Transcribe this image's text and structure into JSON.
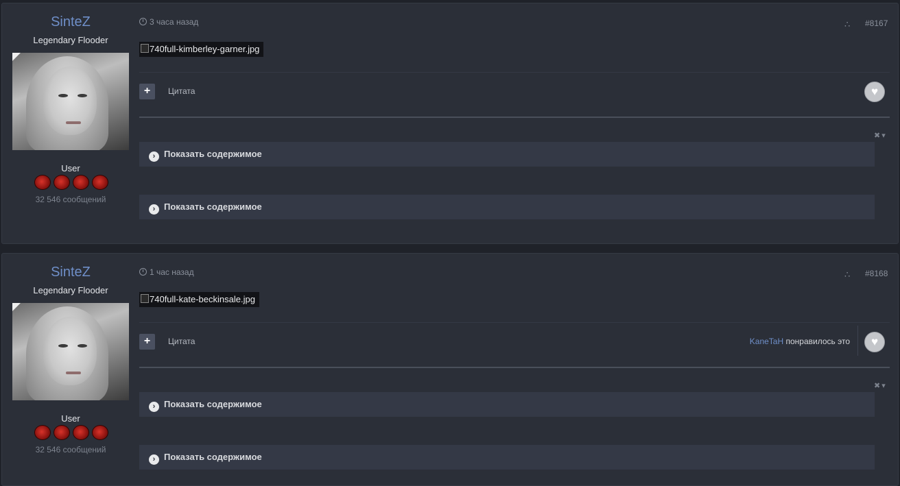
{
  "posts": [
    {
      "author": {
        "name": "SinteZ",
        "title": "Legendary Flooder",
        "group": "User",
        "post_count": "32 546 сообщений"
      },
      "time": "3 часа назад",
      "post_number": "#8167",
      "image_alt": "740full-kimberley-garner.jpg",
      "quote_label": "Цитата",
      "liked_by": "",
      "liked_text": "",
      "spoilers": [
        "Показать содержимое",
        "Показать содержимое"
      ]
    },
    {
      "author": {
        "name": "SinteZ",
        "title": "Legendary Flooder",
        "group": "User",
        "post_count": "32 546 сообщений"
      },
      "time": "1 час назад",
      "post_number": "#8168",
      "image_alt": "740full-kate-beckinsale.jpg",
      "quote_label": "Цитата",
      "liked_by": "KaneTaH",
      "liked_text": "понравилось это",
      "spoilers": [
        "Показать содержимое",
        "Показать содержимое"
      ]
    }
  ],
  "icons": {
    "clock": "clock-icon",
    "share": "share-icon",
    "plus": "plus-icon",
    "heart": "heart-icon",
    "spoiler": "chevron-right-icon",
    "close": "close-icon"
  },
  "colors": {
    "author_name": "#6f8fc9",
    "page_bg": "#1f2229",
    "post_bg": "#2b2f38",
    "spoiler_bg": "#343946"
  }
}
